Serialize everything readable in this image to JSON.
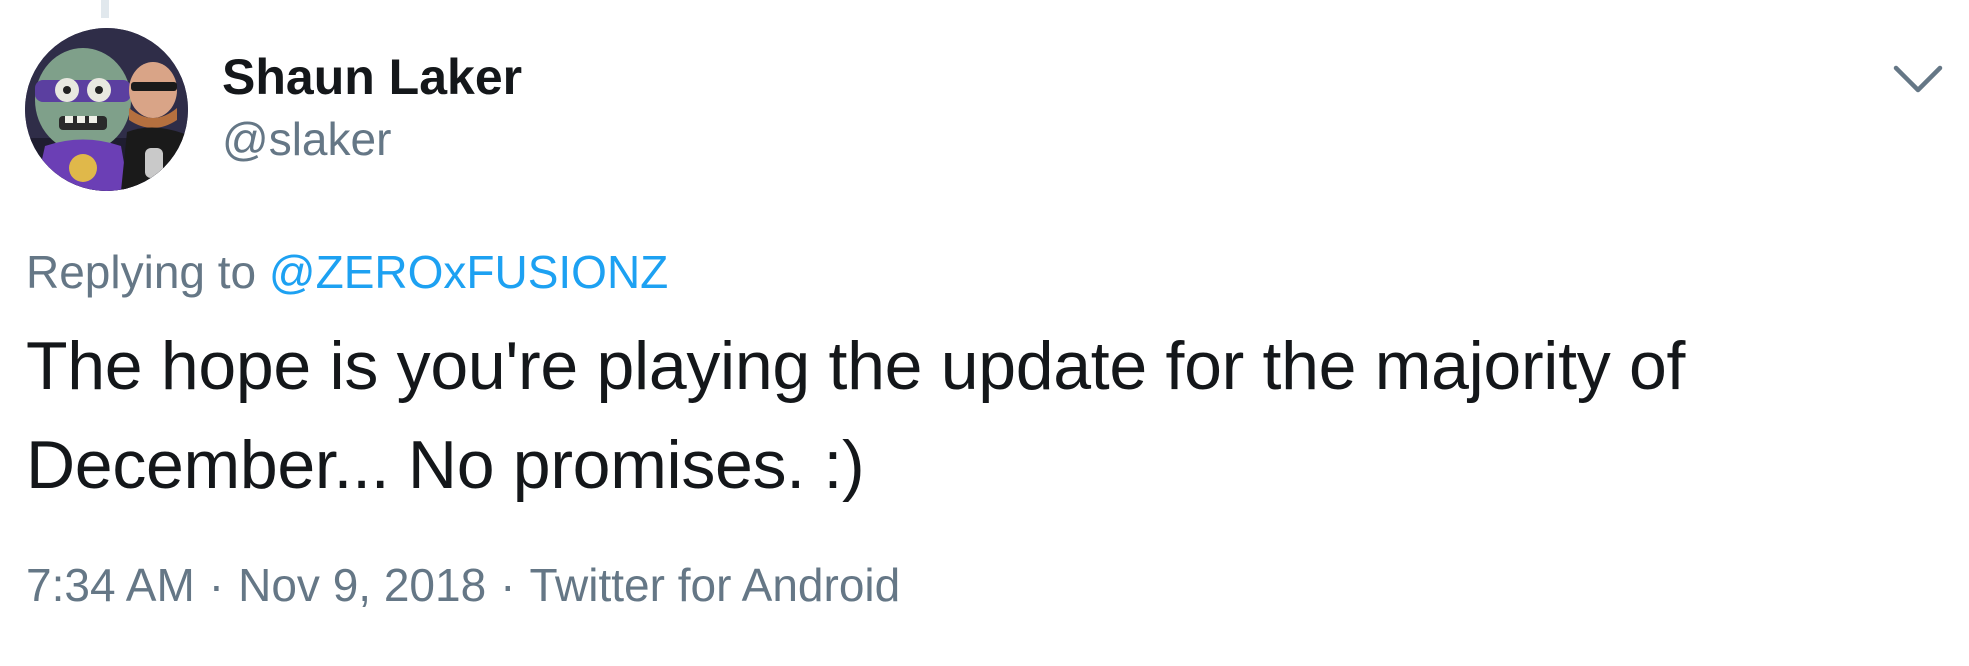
{
  "tweet": {
    "author": {
      "name": "Shaun Laker",
      "handle": "@slaker"
    },
    "reply": {
      "prefix": "Replying to",
      "mention": "@ZEROxFUSIONZ"
    },
    "text_lines": [
      "The hope is you're playing the update for the majority of",
      "December... No promises. :)"
    ],
    "time": "7:34 AM",
    "separator": "·",
    "date": "Nov 9, 2018",
    "source": "Twitter for Android",
    "menu_icon": "chevron-down-icon"
  },
  "colors": {
    "text_primary": "#14171a",
    "text_secondary": "#657786",
    "link": "#1da1f2",
    "thread_line": "#e1e8ed",
    "background": "#ffffff"
  }
}
